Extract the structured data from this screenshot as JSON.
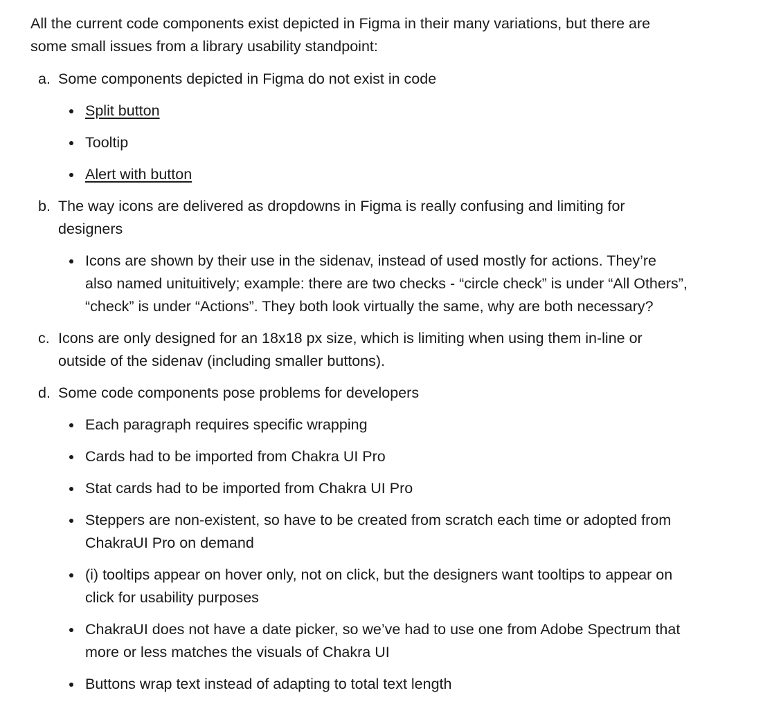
{
  "document": {
    "intro": "All the current code components exist depicted in Figma in their many variations, but there are some small issues from a library usability standpoint:",
    "items": [
      {
        "marker": "a.",
        "text": "Some components depicted in Figma do not exist in code",
        "subitems": [
          {
            "text": "Split button",
            "is_link": true
          },
          {
            "text": "Tooltip",
            "is_link": false
          },
          {
            "text": "Alert with button",
            "is_link": true
          }
        ]
      },
      {
        "marker": "b.",
        "text": "The way icons are delivered as dropdowns in Figma is really confusing and limiting for designers",
        "subitems": [
          {
            "text": "Icons are shown by their use in the sidenav, instead of used mostly for actions. They’re also named unituitively; example: there are two checks - “circle check” is under “All Others”, “check” is under “Actions”. They both look virtually the same, why are both necessary?",
            "is_link": false
          }
        ]
      },
      {
        "marker": "c.",
        "text": "Icons are only designed for an 18x18 px size, which is limiting when using them in-line or outside of the sidenav (including smaller buttons).",
        "subitems": []
      },
      {
        "marker": "d.",
        "text": "Some code components pose problems for developers",
        "subitems": [
          {
            "text": "Each paragraph requires specific wrapping",
            "is_link": false
          },
          {
            "text": "Cards had to be imported from Chakra UI Pro",
            "is_link": false
          },
          {
            "text": "Stat cards had to be imported from Chakra UI Pro",
            "is_link": false
          },
          {
            "text": "Steppers are non-existent, so have to be created from scratch each time or adopted from ChakraUI Pro on demand",
            "is_link": false
          },
          {
            "text": "(i) tooltips appear on hover only, not on click, but the designers want tooltips to appear on click for usability purposes",
            "is_link": false
          },
          {
            "text": "ChakraUI does not have a date picker, so we’ve had to use one from Adobe Spectrum that more or less matches the visuals of Chakra UI",
            "is_link": false
          },
          {
            "text": "Buttons wrap text instead of adapting to total text length",
            "is_link": false
          }
        ]
      }
    ]
  }
}
